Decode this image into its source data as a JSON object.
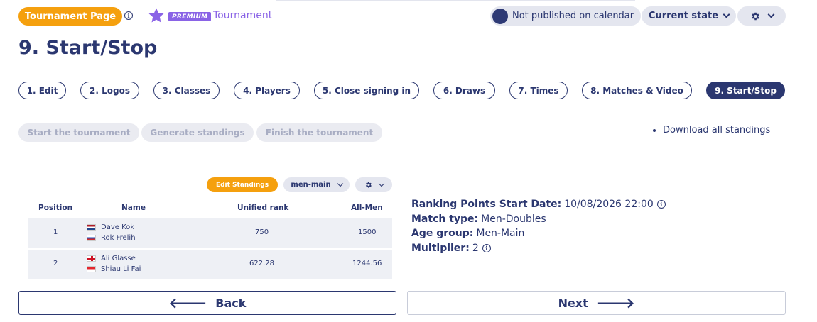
{
  "header": {
    "tournament_page_label": "Tournament Page",
    "premium_label": "PREMIUM",
    "tournament_label": "Tournament",
    "publish_status": "Not published on calendar",
    "current_state_label": "Current state"
  },
  "page_title": "9. Start/Stop",
  "steps": [
    {
      "label": "1. Edit"
    },
    {
      "label": "2. Logos"
    },
    {
      "label": "3. Classes"
    },
    {
      "label": "4. Players"
    },
    {
      "label": "5. Close signing in"
    },
    {
      "label": "6. Draws"
    },
    {
      "label": "7. Times"
    },
    {
      "label": "8. Matches & Video"
    },
    {
      "label": "9. Start/Stop"
    }
  ],
  "actions": {
    "start": "Start the tournament",
    "generate": "Generate standings",
    "finish": "Finish the tournament",
    "download": "Download all standings"
  },
  "standings": {
    "edit_label": "Edit Standings",
    "class_select": "men-main",
    "columns": [
      "Position",
      "Name",
      "Unified rank",
      "All-Men"
    ],
    "rows": [
      {
        "position": "1",
        "players": [
          "Dave Kok",
          "Rok Frelih"
        ],
        "unified_rank": "750",
        "all_men": "1500"
      },
      {
        "position": "2",
        "players": [
          "Ali Glasse",
          "Shiau Li Fai"
        ],
        "unified_rank": "622.28",
        "all_men": "1244.56"
      }
    ]
  },
  "details": {
    "ranking_points_label": "Ranking Points Start Date:",
    "ranking_points_value": "10/08/2026 22:00",
    "match_type_label": "Match type:",
    "match_type_value": "Men-Doubles",
    "age_group_label": "Age group:",
    "age_group_value": "Men-Main",
    "multiplier_label": "Multiplier:",
    "multiplier_value": "2"
  },
  "nav": {
    "back_label": "Back",
    "next_label": "Next",
    "back_arrow": "🡐",
    "next_arrow": "🡒"
  },
  "colors": {
    "primary": "#2b3770",
    "accent_orange": "#f5a00e",
    "premium_purple": "#8a63e6",
    "pill_bg": "#e4e6ef"
  }
}
